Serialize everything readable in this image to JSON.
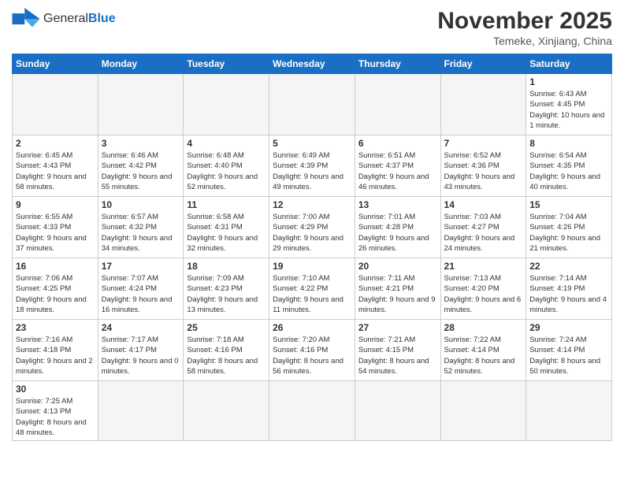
{
  "header": {
    "logo_text_normal": "General",
    "logo_text_bold": "Blue",
    "month_title": "November 2025",
    "location": "Temeke, Xinjiang, China"
  },
  "weekdays": [
    "Sunday",
    "Monday",
    "Tuesday",
    "Wednesday",
    "Thursday",
    "Friday",
    "Saturday"
  ],
  "weeks": [
    [
      {
        "day": "",
        "empty": true
      },
      {
        "day": "",
        "empty": true
      },
      {
        "day": "",
        "empty": true
      },
      {
        "day": "",
        "empty": true
      },
      {
        "day": "",
        "empty": true
      },
      {
        "day": "",
        "empty": true
      },
      {
        "day": "1",
        "info": "Sunrise: 6:43 AM\nSunset: 4:45 PM\nDaylight: 10 hours and 1 minute."
      }
    ],
    [
      {
        "day": "2",
        "info": "Sunrise: 6:45 AM\nSunset: 4:43 PM\nDaylight: 9 hours and 58 minutes."
      },
      {
        "day": "3",
        "info": "Sunrise: 6:46 AM\nSunset: 4:42 PM\nDaylight: 9 hours and 55 minutes."
      },
      {
        "day": "4",
        "info": "Sunrise: 6:48 AM\nSunset: 4:40 PM\nDaylight: 9 hours and 52 minutes."
      },
      {
        "day": "5",
        "info": "Sunrise: 6:49 AM\nSunset: 4:39 PM\nDaylight: 9 hours and 49 minutes."
      },
      {
        "day": "6",
        "info": "Sunrise: 6:51 AM\nSunset: 4:37 PM\nDaylight: 9 hours and 46 minutes."
      },
      {
        "day": "7",
        "info": "Sunrise: 6:52 AM\nSunset: 4:36 PM\nDaylight: 9 hours and 43 minutes."
      },
      {
        "day": "8",
        "info": "Sunrise: 6:54 AM\nSunset: 4:35 PM\nDaylight: 9 hours and 40 minutes."
      }
    ],
    [
      {
        "day": "9",
        "info": "Sunrise: 6:55 AM\nSunset: 4:33 PM\nDaylight: 9 hours and 37 minutes."
      },
      {
        "day": "10",
        "info": "Sunrise: 6:57 AM\nSunset: 4:32 PM\nDaylight: 9 hours and 34 minutes."
      },
      {
        "day": "11",
        "info": "Sunrise: 6:58 AM\nSunset: 4:31 PM\nDaylight: 9 hours and 32 minutes."
      },
      {
        "day": "12",
        "info": "Sunrise: 7:00 AM\nSunset: 4:29 PM\nDaylight: 9 hours and 29 minutes."
      },
      {
        "day": "13",
        "info": "Sunrise: 7:01 AM\nSunset: 4:28 PM\nDaylight: 9 hours and 26 minutes."
      },
      {
        "day": "14",
        "info": "Sunrise: 7:03 AM\nSunset: 4:27 PM\nDaylight: 9 hours and 24 minutes."
      },
      {
        "day": "15",
        "info": "Sunrise: 7:04 AM\nSunset: 4:26 PM\nDaylight: 9 hours and 21 minutes."
      }
    ],
    [
      {
        "day": "16",
        "info": "Sunrise: 7:06 AM\nSunset: 4:25 PM\nDaylight: 9 hours and 18 minutes."
      },
      {
        "day": "17",
        "info": "Sunrise: 7:07 AM\nSunset: 4:24 PM\nDaylight: 9 hours and 16 minutes."
      },
      {
        "day": "18",
        "info": "Sunrise: 7:09 AM\nSunset: 4:23 PM\nDaylight: 9 hours and 13 minutes."
      },
      {
        "day": "19",
        "info": "Sunrise: 7:10 AM\nSunset: 4:22 PM\nDaylight: 9 hours and 11 minutes."
      },
      {
        "day": "20",
        "info": "Sunrise: 7:11 AM\nSunset: 4:21 PM\nDaylight: 9 hours and 9 minutes."
      },
      {
        "day": "21",
        "info": "Sunrise: 7:13 AM\nSunset: 4:20 PM\nDaylight: 9 hours and 6 minutes."
      },
      {
        "day": "22",
        "info": "Sunrise: 7:14 AM\nSunset: 4:19 PM\nDaylight: 9 hours and 4 minutes."
      }
    ],
    [
      {
        "day": "23",
        "info": "Sunrise: 7:16 AM\nSunset: 4:18 PM\nDaylight: 9 hours and 2 minutes."
      },
      {
        "day": "24",
        "info": "Sunrise: 7:17 AM\nSunset: 4:17 PM\nDaylight: 9 hours and 0 minutes."
      },
      {
        "day": "25",
        "info": "Sunrise: 7:18 AM\nSunset: 4:16 PM\nDaylight: 8 hours and 58 minutes."
      },
      {
        "day": "26",
        "info": "Sunrise: 7:20 AM\nSunset: 4:16 PM\nDaylight: 8 hours and 56 minutes."
      },
      {
        "day": "27",
        "info": "Sunrise: 7:21 AM\nSunset: 4:15 PM\nDaylight: 8 hours and 54 minutes."
      },
      {
        "day": "28",
        "info": "Sunrise: 7:22 AM\nSunset: 4:14 PM\nDaylight: 8 hours and 52 minutes."
      },
      {
        "day": "29",
        "info": "Sunrise: 7:24 AM\nSunset: 4:14 PM\nDaylight: 8 hours and 50 minutes."
      }
    ],
    [
      {
        "day": "30",
        "info": "Sunrise: 7:25 AM\nSunset: 4:13 PM\nDaylight: 8 hours and 48 minutes."
      },
      {
        "day": "",
        "empty": true
      },
      {
        "day": "",
        "empty": true
      },
      {
        "day": "",
        "empty": true
      },
      {
        "day": "",
        "empty": true
      },
      {
        "day": "",
        "empty": true
      },
      {
        "day": "",
        "empty": true
      }
    ]
  ]
}
